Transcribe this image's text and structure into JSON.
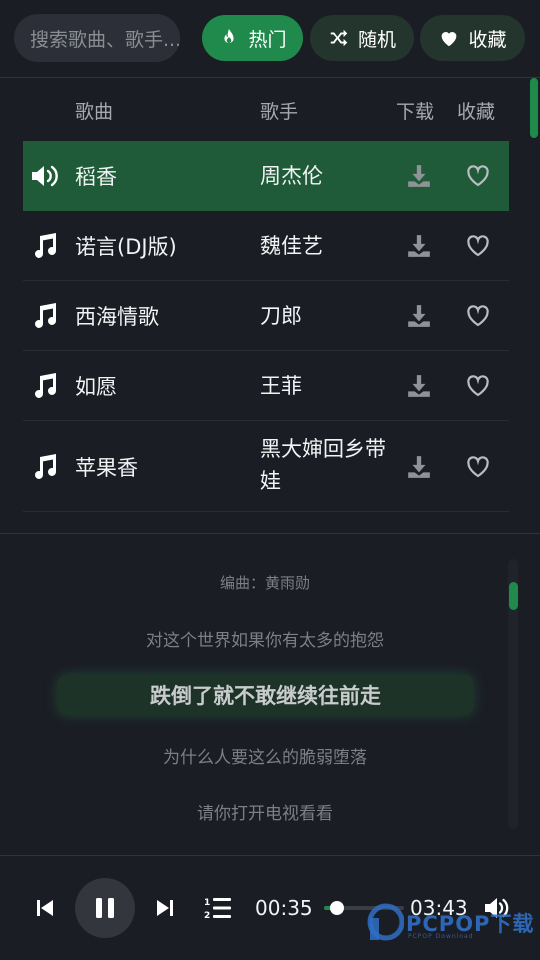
{
  "header": {
    "search_placeholder": "搜索歌曲、歌手...",
    "hot_label": "热门",
    "shuffle_label": "随机",
    "favorites_label": "收藏"
  },
  "table": {
    "headers": {
      "song": "歌曲",
      "artist": "歌手",
      "download": "下载",
      "favorite": "收藏"
    },
    "rows": [
      {
        "name": "稻香",
        "artist": "周杰伦",
        "playing": true,
        "lead_icon": "speaker-icon"
      },
      {
        "name": "诺言(DJ版)",
        "artist": "魏佳艺",
        "playing": false,
        "lead_icon": "music-note-icon"
      },
      {
        "name": "西海情歌",
        "artist": "刀郎",
        "playing": false,
        "lead_icon": "music-note-icon"
      },
      {
        "name": "如愿",
        "artist": "王菲",
        "playing": false,
        "lead_icon": "music-note-icon"
      },
      {
        "name": "苹果香",
        "artist": "黑大婶回乡带娃",
        "playing": false,
        "lead_icon": "music-note-icon"
      }
    ]
  },
  "lyrics": {
    "lines": [
      "编曲：黄雨勋",
      "对这个世界如果你有太多的抱怨",
      "跌倒了就不敢继续往前走",
      "为什么人要这么的脆弱堕落",
      "请你打开电视看看"
    ],
    "current_index": 2
  },
  "player": {
    "current_time": "00:35",
    "total_time": "03:43",
    "progress": 0.157,
    "state": "playing"
  },
  "watermark": {
    "text": "PCPOP下载",
    "sub": "PCPOP Download"
  },
  "colors": {
    "accent": "#1f8a4c",
    "background": "#1b1d24",
    "active_row": "#1f5b38"
  }
}
